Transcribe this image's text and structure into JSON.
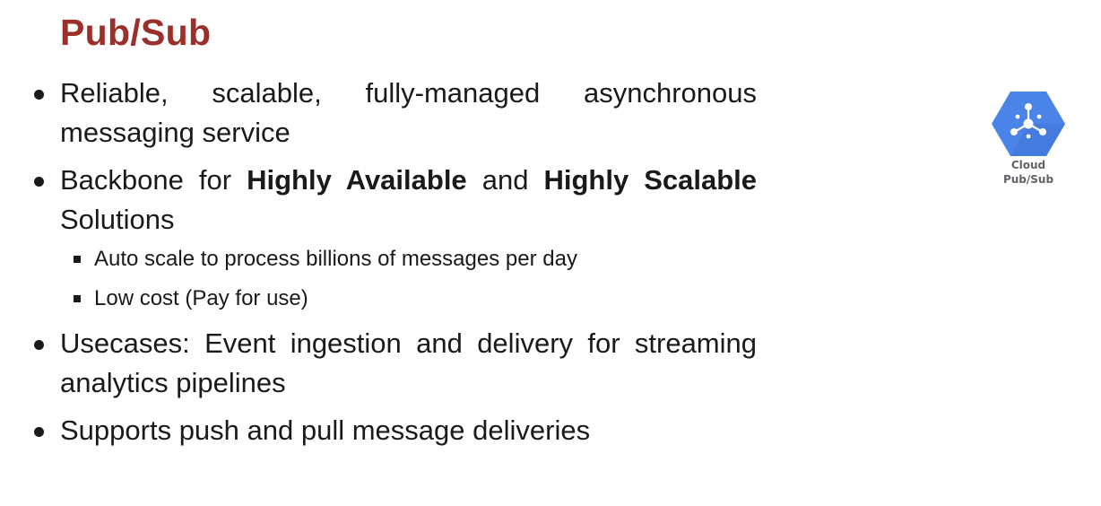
{
  "title": "Pub/Sub",
  "bullets": [
    {
      "text": "Reliable, scalable, fully-managed asynchronous messaging service"
    },
    {
      "prefix": "Backbone for ",
      "bold1": "Highly Available",
      "middle": " and ",
      "bold2": "Highly Scalable",
      "suffix": " Solutions",
      "sub_items": [
        "Auto scale to process billions of messages per day",
        "Low cost (Pay for use)"
      ]
    },
    {
      "text": "Usecases: Event ingestion and delivery for streaming analytics pipelines"
    },
    {
      "text": "Supports push and pull message deliveries"
    }
  ],
  "logo": {
    "icon": "cloud-pubsub-icon",
    "line1": "Cloud",
    "line2": "Pub/Sub",
    "color": "#4a84e8"
  }
}
